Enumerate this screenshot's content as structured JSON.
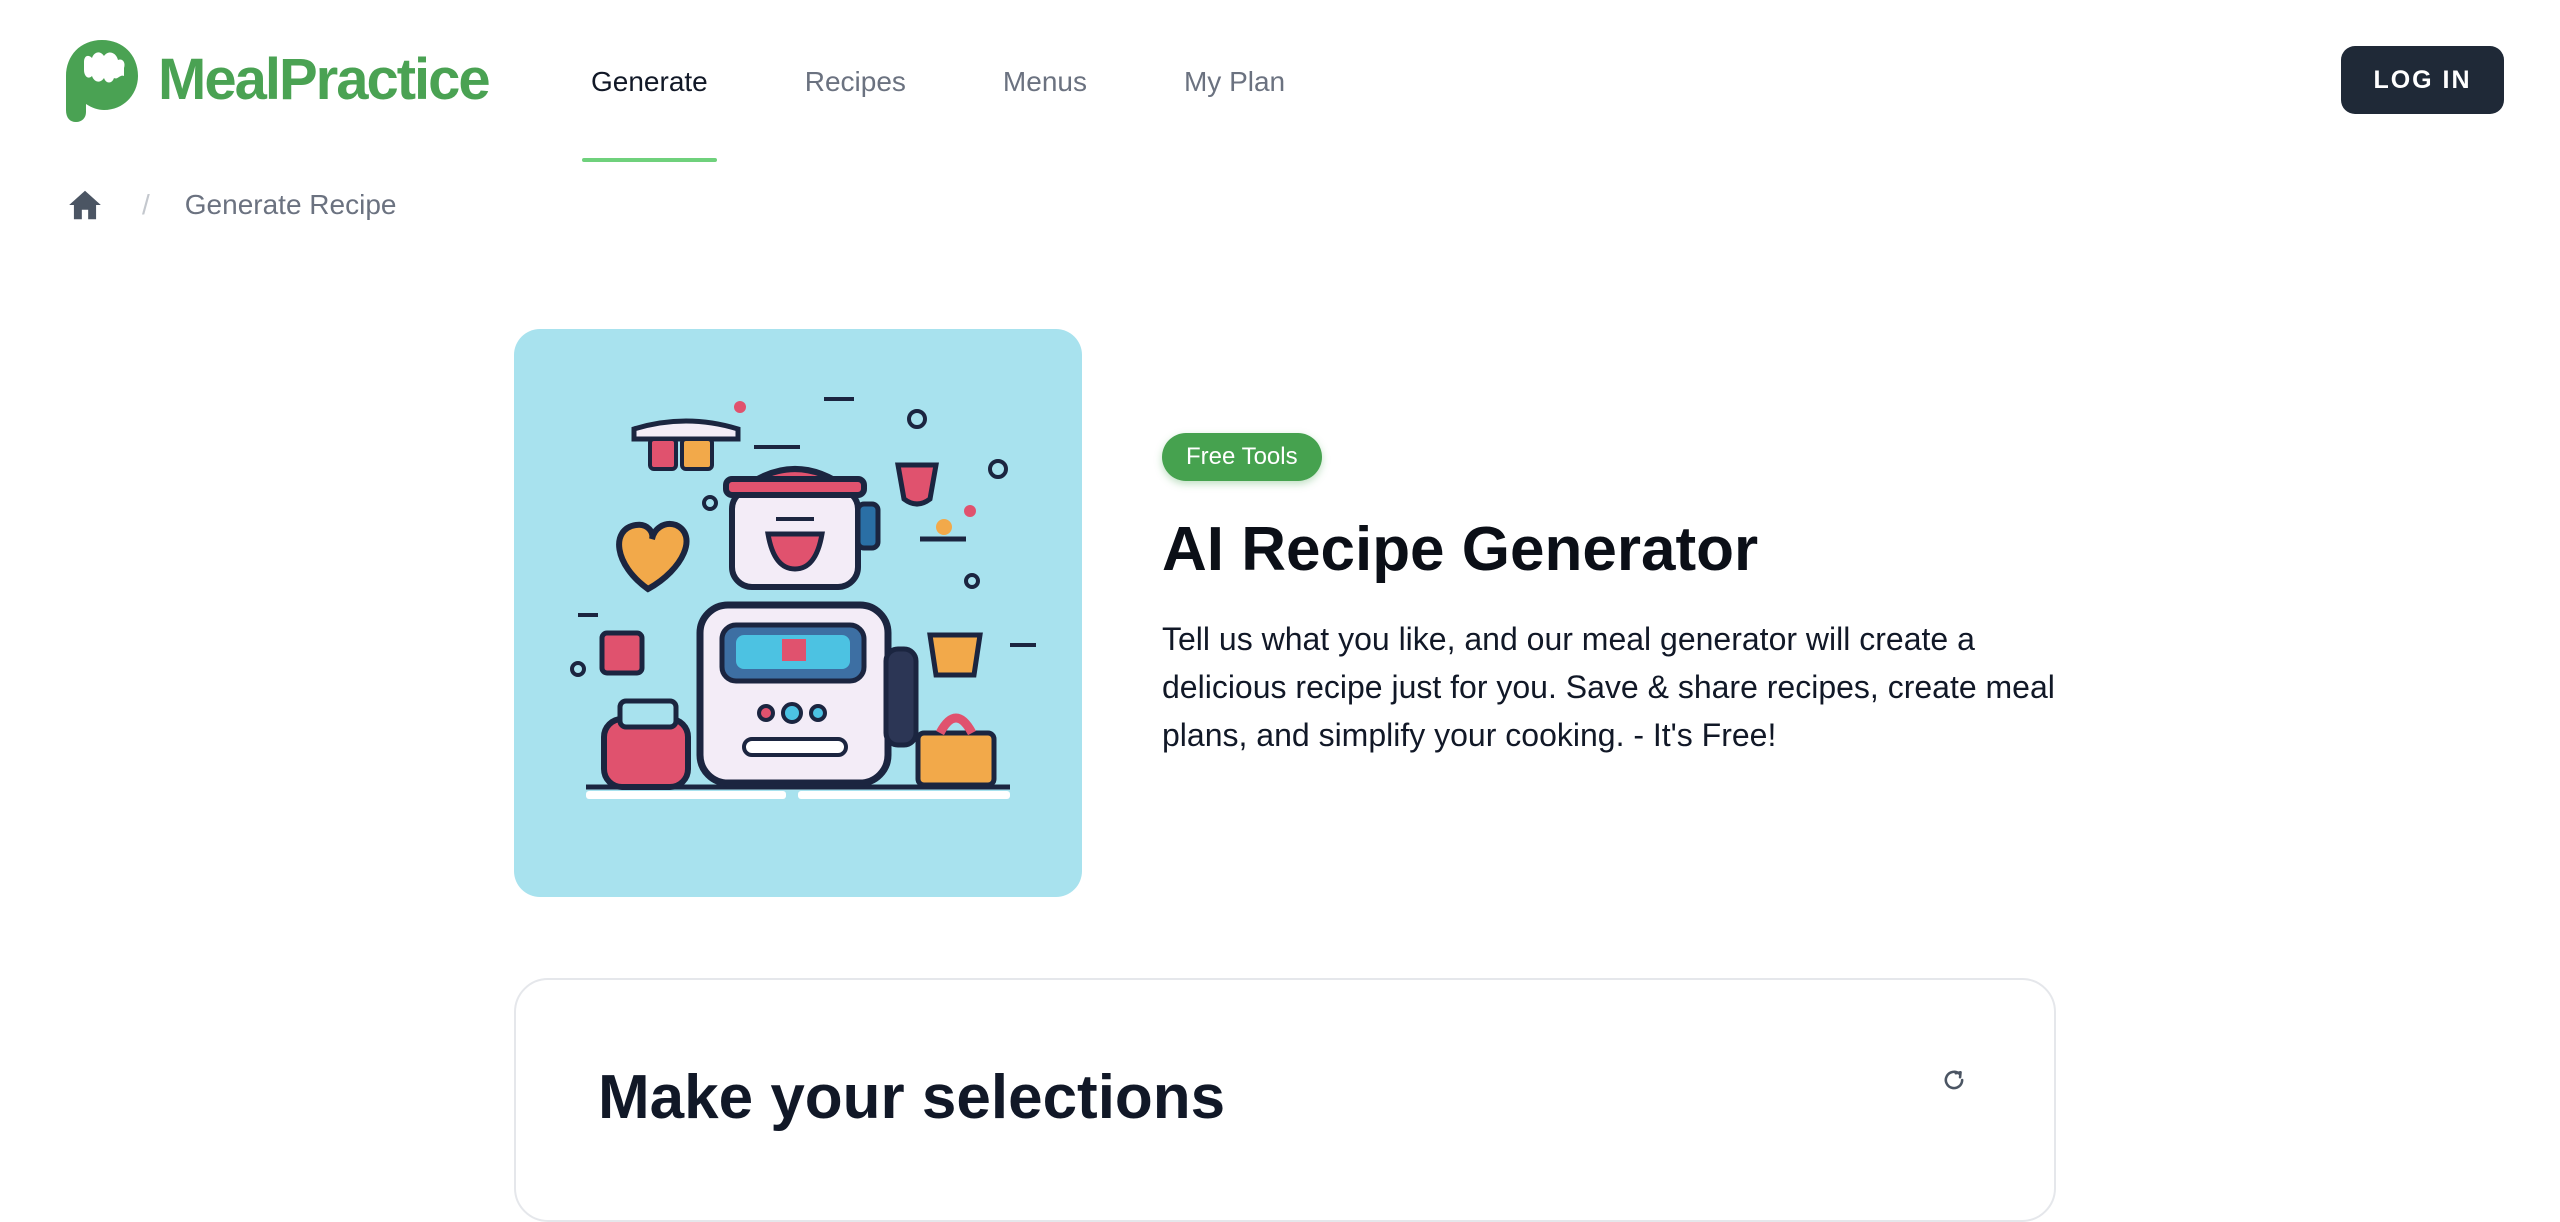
{
  "brand": {
    "name": "MealPractice",
    "color": "#4aa253",
    "logo_icon": "mealpractice-logo-icon"
  },
  "nav": {
    "items": [
      {
        "label": "Generate",
        "active": true
      },
      {
        "label": "Recipes",
        "active": false
      },
      {
        "label": "Menus",
        "active": false
      },
      {
        "label": "My Plan",
        "active": false
      }
    ]
  },
  "header": {
    "login_label": "LOG IN"
  },
  "breadcrumb": {
    "home_icon": "home-icon",
    "separator": "/",
    "current": "Generate Recipe"
  },
  "hero": {
    "badge": "Free Tools",
    "title": "AI Recipe Generator",
    "description": "Tell us what you like, and our meal generator will create a delicious recipe just for you. Save & share recipes, create meal plans, and simplify your cooking. - It's Free!",
    "image_icon": "robot-kitchen-illustration"
  },
  "selections": {
    "title": "Make your selections",
    "refresh_icon": "refresh-icon"
  },
  "colors": {
    "accent": "#46a24f",
    "nav_underline": "#6fd17c",
    "dark_button": "#1f2937",
    "hero_bg": "#a8e2ee"
  }
}
